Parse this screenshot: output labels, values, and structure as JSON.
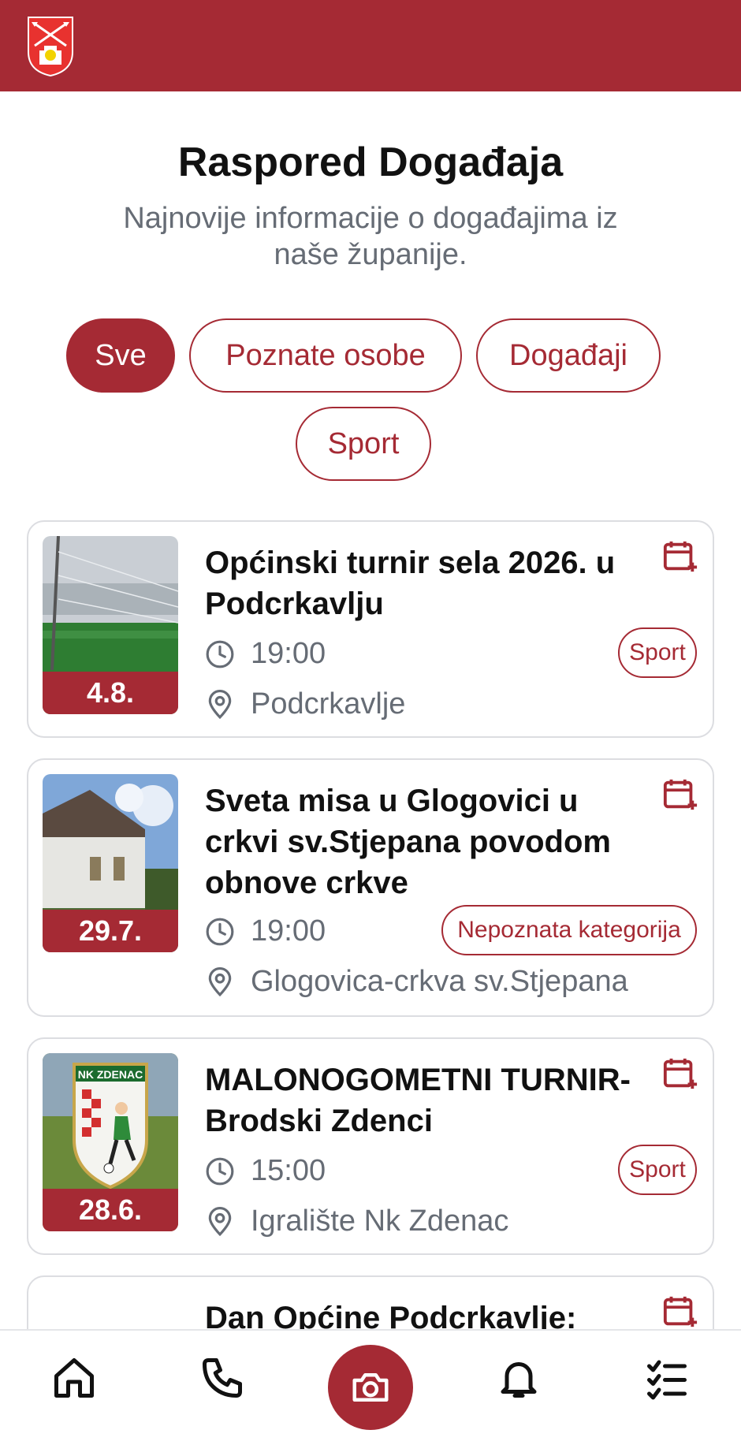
{
  "header": {
    "logo_name": "municipality-coat-of-arms",
    "brand_color": "#a52a34"
  },
  "page": {
    "title": "Raspored Događaja",
    "subtitle": "Najnovije informacije o događajima iz naše županije."
  },
  "filters": [
    {
      "label": "Sve",
      "active": true
    },
    {
      "label": "Poznate osobe",
      "active": false
    },
    {
      "label": "Događaji",
      "active": false
    },
    {
      "label": "Sport",
      "active": false
    }
  ],
  "events": [
    {
      "title": "Općinski turnir sela 2026. u Podcrkavlju",
      "date": "4.8.",
      "time": "19:00",
      "location": "Podcrkavlje",
      "category": "Sport"
    },
    {
      "title": "Sveta misa u Glogovici u crkvi sv.Stjepana povodom obnove crkve",
      "date": "29.7.",
      "time": "19:00",
      "location": "Glogovica-crkva sv.Stjepana",
      "category": "Nepoznata kategorija"
    },
    {
      "title": "MALONOGOMETNI TURNIR- Brodski Zdenci",
      "date": "28.6.",
      "time": "15:00",
      "location": "Igralište Nk Zdenac",
      "category": "Sport",
      "image_text": "NK ZDENAC"
    },
    {
      "title": "Dan Općine Podcrkavlje:"
    }
  ],
  "bottom_nav": [
    {
      "icon": "home-icon"
    },
    {
      "icon": "phone-icon"
    },
    {
      "icon": "camera-icon"
    },
    {
      "icon": "bell-icon"
    },
    {
      "icon": "checklist-icon"
    }
  ]
}
